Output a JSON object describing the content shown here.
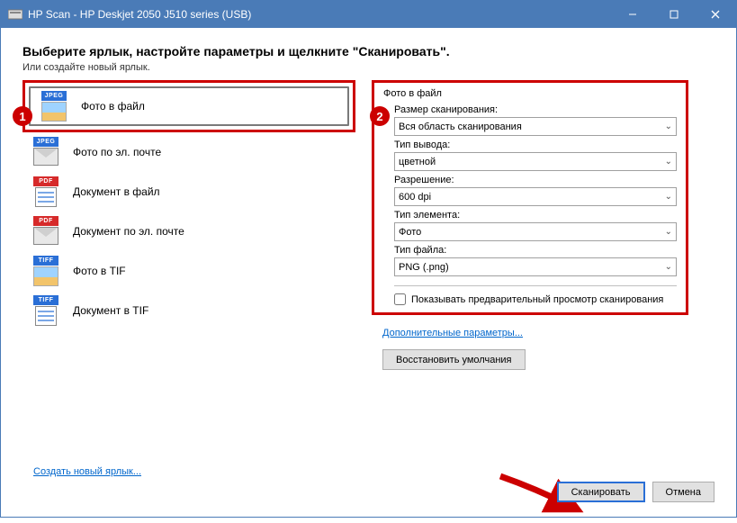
{
  "window": {
    "title": "HP Scan - HP Deskjet 2050 J510 series (USB)"
  },
  "heading": "Выберите ярлык, настройте параметры и щелкните \"Сканировать\".",
  "subheading": "Или создайте новый ярлык.",
  "steps": {
    "one": "1",
    "two": "2"
  },
  "shortcuts": [
    {
      "label": "Фото в файл",
      "badge": "JPEG",
      "icon": "pic"
    },
    {
      "label": "Фото по эл. почте",
      "badge": "JPEG",
      "icon": "env"
    },
    {
      "label": "Документ в файл",
      "badge": "PDF",
      "icon": "doc"
    },
    {
      "label": "Документ по эл. почте",
      "badge": "PDF",
      "icon": "env"
    },
    {
      "label": "Фото в TIF",
      "badge": "TIFF",
      "icon": "pic"
    },
    {
      "label": "Документ в TIF",
      "badge": "TIFF",
      "icon": "doc"
    }
  ],
  "settings": {
    "group_title": "Фото в файл",
    "scan_size_label": "Размер сканирования:",
    "scan_size_value": "Вся область сканирования",
    "output_type_label": "Тип вывода:",
    "output_type_value": "цветной",
    "resolution_label": "Разрешение:",
    "resolution_value": "600 dpi",
    "element_type_label": "Тип элемента:",
    "element_type_value": "Фото",
    "file_type_label": "Тип файла:",
    "file_type_value": "PNG (.png)",
    "preview_label": "Показывать предварительный просмотр сканирования"
  },
  "links": {
    "advanced": "Дополнительные параметры...",
    "create_new": "Создать новый ярлык..."
  },
  "buttons": {
    "restore_defaults": "Восстановить умолчания",
    "scan": "Сканировать",
    "cancel": "Отмена"
  }
}
